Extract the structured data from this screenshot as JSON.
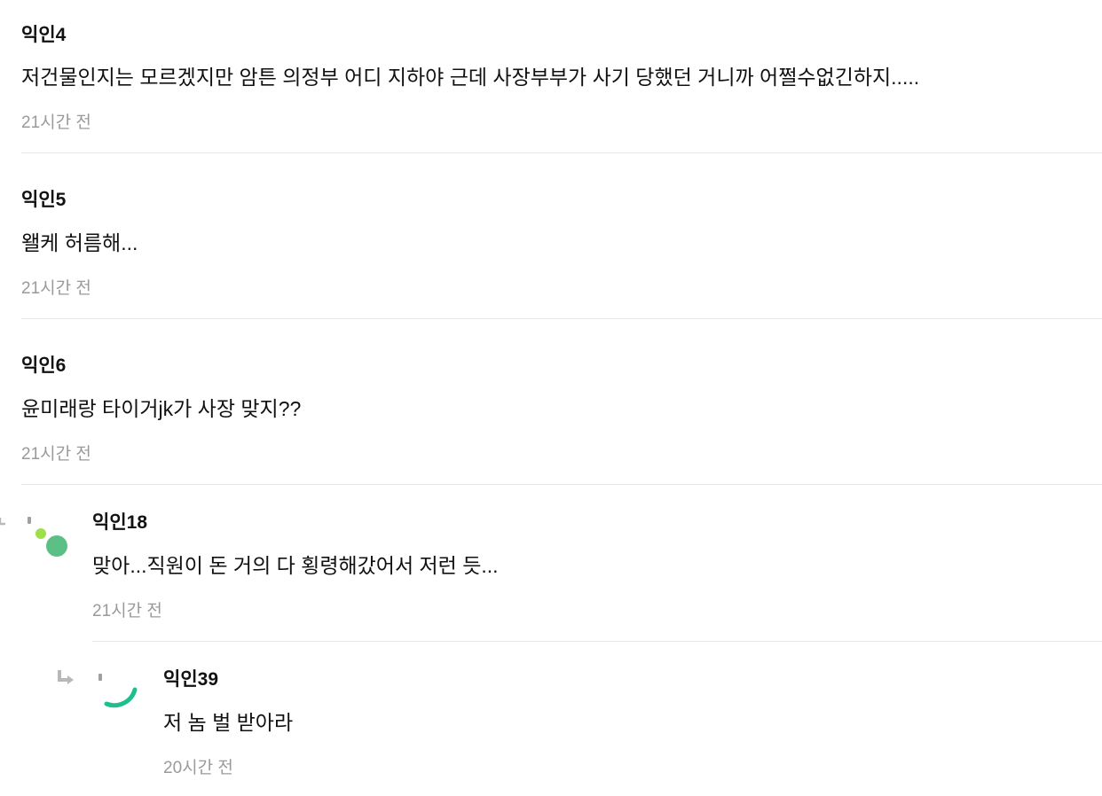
{
  "comments": [
    {
      "author": "익인4",
      "text": "저건물인지는 모르겠지만 암튼 의정부 어디 지하야 근데 사장부부가 사기 당했던 거니까 어쩔수없긴하지.....",
      "time": "21시간 전"
    },
    {
      "author": "익인5",
      "text": "왤케 허름해...",
      "time": "21시간 전"
    },
    {
      "author": "익인6",
      "text": "윤미래랑 타이거jk가 사장 맞지??",
      "time": "21시간 전"
    },
    {
      "author": "익인18",
      "text": "맞아...직원이 돈 거의 다 횡령해갔어서 저런 듯...",
      "time": "21시간 전"
    },
    {
      "author": "익인39",
      "text": "저 놈 벌 받아라",
      "time": "20시간 전"
    }
  ],
  "icons": {
    "reply": "reply-arrow-icon",
    "avatar_green": "#5cbf85",
    "avatar_lime": "#9ee04a",
    "avatar_teal": "#1dbf8e",
    "arrow_color": "#b8b8b8"
  }
}
